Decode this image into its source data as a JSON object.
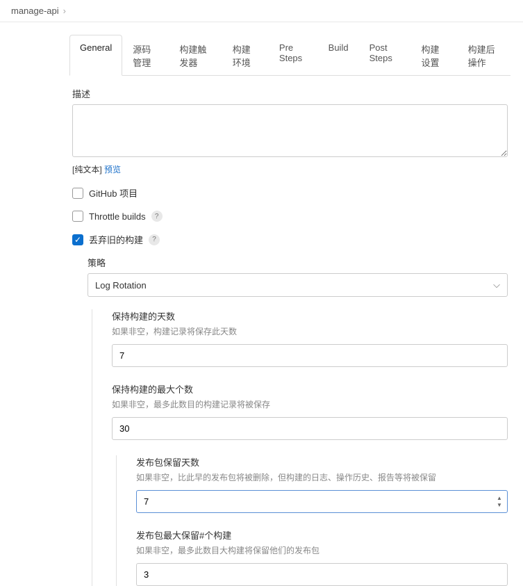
{
  "breadcrumb": {
    "item": "manage-api"
  },
  "tabs": {
    "general": "General",
    "scm": "源码管理",
    "triggers": "构建触发器",
    "env": "构建环境",
    "pre": "Pre Steps",
    "build": "Build",
    "post": "Post Steps",
    "settings": "构建设置",
    "postbuild": "构建后操作"
  },
  "form": {
    "description_label": "描述",
    "plaintext_prefix": "[纯文本] ",
    "preview_link": "预览",
    "github_label": "GitHub 项目",
    "throttle_label": "Throttle builds",
    "discard_label": "丢弃旧的构建",
    "strategy_label": "策略",
    "strategy_value": "Log Rotation",
    "days_keep": {
      "label": "保持构建的天数",
      "help": "如果非空，构建记录将保存此天数",
      "value": "7"
    },
    "max_keep": {
      "label": "保持构建的最大个数",
      "help": "如果非空，最多此数目的构建记录将被保存",
      "value": "30"
    },
    "artifact_days": {
      "label": "发布包保留天数",
      "help": "如果非空，比此早的发布包将被删除，但构建的日志、操作历史、报告等将被保留",
      "value": "7"
    },
    "artifact_max": {
      "label": "发布包最大保留#个构建",
      "help": "如果非空，最多此数目大构建将保留他们的发布包",
      "value": "3"
    }
  }
}
